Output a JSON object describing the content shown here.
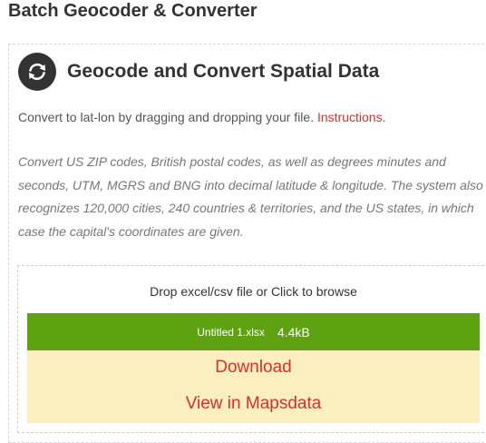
{
  "page": {
    "title": "Batch Geocoder & Converter"
  },
  "section": {
    "icon": "refresh-icon",
    "title": "Geocode and Convert Spatial Data",
    "intro_text": "Convert to lat-lon by dragging and dropping your file.",
    "instructions_link": "Instructions",
    "intro_period": ".",
    "description": "Convert US ZIP codes, British postal codes, as well as degrees minutes and seconds, UTM, MGRS and BNG into decimal latitude & longitude. The system also recognizes 120,000 cities, 240 countries & territories, and the US states, in which case the capital's coordinates are given."
  },
  "dropzone": {
    "label": "Drop excel/csv file or Click to browse",
    "file": {
      "name": "Untitled 1.xlsx",
      "size": "4.4kB"
    },
    "download_label": "Download",
    "view_label": "View in Mapsdata"
  },
  "colors": {
    "accent": "#d9302a",
    "file_bar": "#5ea111",
    "panel": "#fcefbf"
  }
}
